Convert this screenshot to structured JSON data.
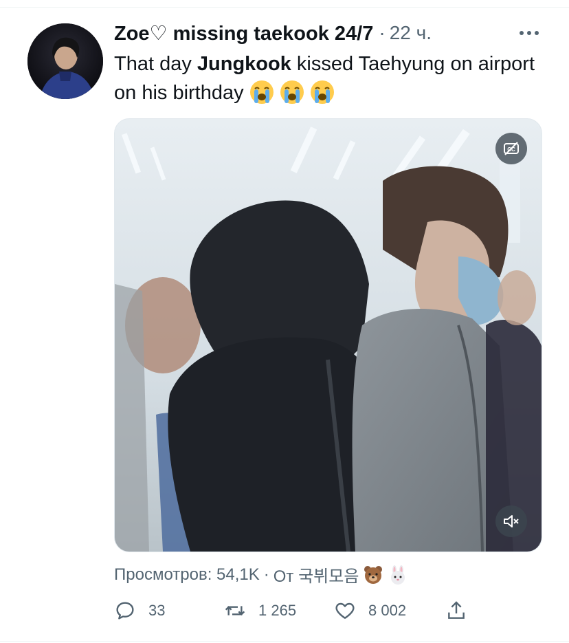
{
  "tweet": {
    "display_name": "Zoe♡ missing taekook 24/7",
    "separator": "·",
    "time": "22 ч.",
    "text_part1": "That day ",
    "text_bold": "Jungkook",
    "text_part2": " kissed Taehyung on airport on his birthday",
    "text_emojis": [
      "loudly-crying-face",
      "loudly-crying-face",
      "loudly-crying-face"
    ]
  },
  "media": {
    "type": "video",
    "cc_icon": "captions-off-icon",
    "mute_icon": "muted-speaker-icon"
  },
  "views": {
    "label": "Просмотров: 54,1K",
    "separator": "·",
    "source": "От 국뷔모음",
    "source_emojis": [
      "bear-face",
      "rabbit-face"
    ]
  },
  "actions": {
    "replies": "33",
    "retweets": "1 265",
    "likes": "8 002"
  },
  "colors": {
    "text": "#0f1419",
    "secondary": "#536471",
    "border": "#eff3f4"
  }
}
